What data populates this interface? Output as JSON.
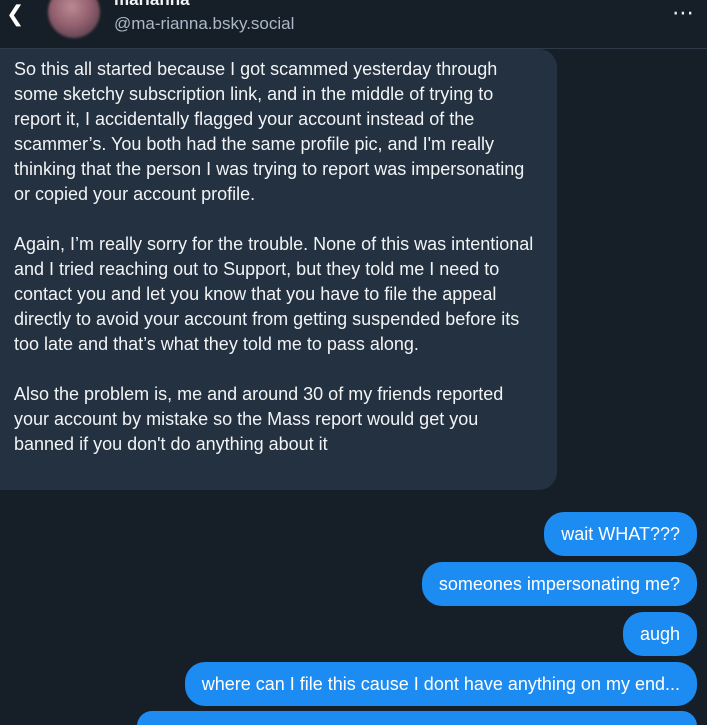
{
  "header": {
    "back_icon": "chevron-left-icon",
    "display_name": "marianna",
    "handle": "@ma-rianna.bsky.social",
    "more_icon": "more-horizontal-icon"
  },
  "messages": {
    "incoming": {
      "paragraphs": [
        "So this all started because I got scammed yesterday through some sketchy subscription link, and in the middle of trying to report it, I accidentally flagged your account instead of the scammer’s. You both had the same profile pic, and I'm really thinking that the person I was trying to report was impersonating or copied your account profile.",
        "Again, I’m really sorry for the trouble. None of this was intentional and I tried reaching out to Support, but they told me I need to contact you and let you know that you have to file the appeal directly to avoid your account from getting suspended before its too late and that’s what they told me to pass along.",
        "Also the problem is, me and around 30 of my friends reported your account by mistake so the Mass report would get you banned if you don't do anything about it"
      ]
    },
    "outgoing": [
      "wait WHAT???",
      "someones impersonating me?",
      "augh",
      "where can I file this cause I dont have anything on my end..."
    ]
  },
  "colors": {
    "background": "#161e27",
    "incoming_bubble": "#243140",
    "outgoing_bubble": "#1d8cf2",
    "handle_text": "#aab8c7"
  }
}
